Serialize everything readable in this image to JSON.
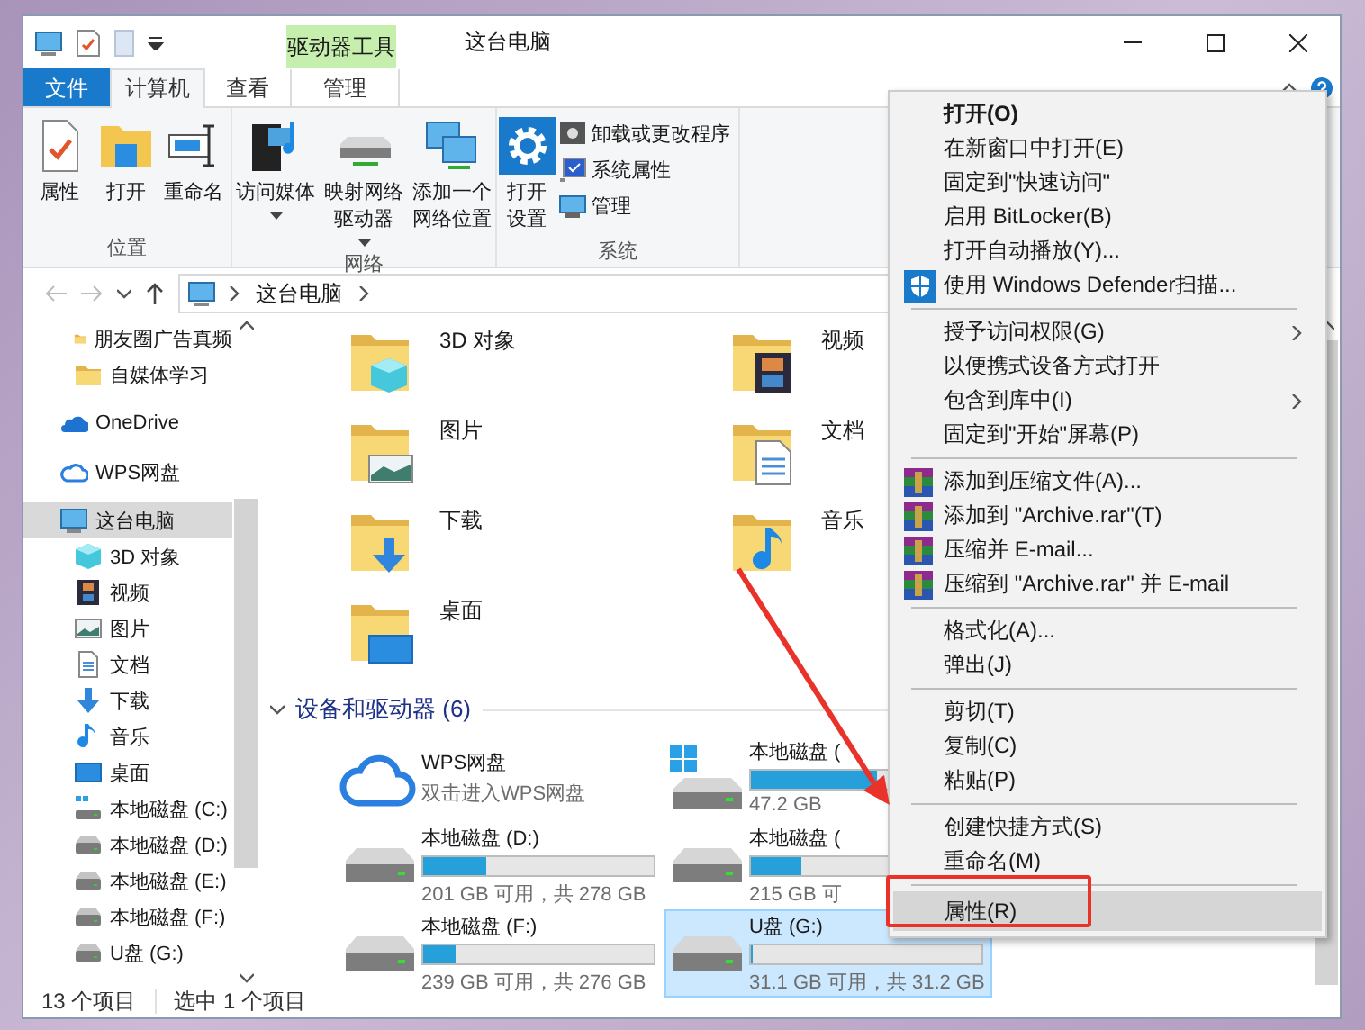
{
  "window": {
    "title": "这台电脑",
    "context_tab_group": "驱动器工具"
  },
  "tabs": [
    {
      "label": "文件",
      "kind": "file",
      "selected": false
    },
    {
      "label": "计算机",
      "kind": "normal",
      "selected": true
    },
    {
      "label": "查看",
      "kind": "normal",
      "selected": false
    },
    {
      "label": "管理",
      "kind": "context",
      "selected": false
    }
  ],
  "ribbon": {
    "groups": [
      {
        "label": "位置",
        "large_buttons": [
          {
            "label": "属性",
            "kind": "properties",
            "dropdown": false
          },
          {
            "label": "打开",
            "kind": "open",
            "dropdown": false
          },
          {
            "label": "重命名",
            "kind": "rename",
            "dropdown": false
          }
        ]
      },
      {
        "label": "网络",
        "large_buttons": [
          {
            "label": "访问媒体",
            "kind": "media",
            "dropdown": true
          },
          {
            "label": "映射网络驱动器",
            "kind": "map-drive",
            "dropdown": true
          },
          {
            "label": "添加一个网络位置",
            "kind": "network-location",
            "dropdown": false
          }
        ]
      },
      {
        "label": "系统",
        "large_buttons": [
          {
            "label": "打开设置",
            "kind": "settings",
            "dropdown": false
          }
        ],
        "small_buttons": [
          {
            "label": "卸载或更改程序",
            "kind": "programs"
          },
          {
            "label": "系统属性",
            "kind": "system-properties"
          },
          {
            "label": "管理",
            "kind": "manage"
          }
        ]
      }
    ]
  },
  "address": {
    "path": [
      "这台电脑"
    ]
  },
  "sidebar": {
    "items": [
      {
        "label": "朋友圈广告真频",
        "kind": "folder",
        "selected": false
      },
      {
        "label": "自媒体学习",
        "kind": "folder",
        "selected": false
      },
      {
        "label": "OneDrive",
        "kind": "onedrive",
        "selected": false
      },
      {
        "label": "WPS网盘",
        "kind": "cloud",
        "selected": false
      },
      {
        "label": "这台电脑",
        "kind": "computer",
        "selected": true,
        "children": [
          {
            "label": "3D 对象",
            "kind": "cube",
            "selected": false
          },
          {
            "label": "视频",
            "kind": "video",
            "selected": false
          },
          {
            "label": "图片",
            "kind": "picture",
            "selected": false
          },
          {
            "label": "文档",
            "kind": "document",
            "selected": false
          },
          {
            "label": "下载",
            "kind": "download",
            "selected": false
          },
          {
            "label": "音乐",
            "kind": "music",
            "selected": false
          },
          {
            "label": "桌面",
            "kind": "desktop",
            "selected": false
          },
          {
            "label": "本地磁盘 (C:)",
            "kind": "system-drive",
            "selected": false
          },
          {
            "label": "本地磁盘 (D:)",
            "kind": "drive",
            "selected": false
          },
          {
            "label": "本地磁盘 (E:)",
            "kind": "drive",
            "selected": false
          },
          {
            "label": "本地磁盘 (F:)",
            "kind": "drive",
            "selected": false
          },
          {
            "label": "U盘 (G:)",
            "kind": "drive",
            "selected": false
          }
        ]
      }
    ]
  },
  "folders": [
    {
      "label": "3D 对象",
      "kind": "cube"
    },
    {
      "label": "视频",
      "kind": "video"
    },
    {
      "label": "图片",
      "kind": "picture"
    },
    {
      "label": "文档",
      "kind": "document"
    },
    {
      "label": "下载",
      "kind": "download"
    },
    {
      "label": "音乐",
      "kind": "music"
    },
    {
      "label": "桌面",
      "kind": "desktop"
    }
  ],
  "devices": {
    "title": "设备和驱动器 (6)",
    "expanded": true,
    "drives": [
      {
        "name": "WPS网盘",
        "kind": "cloud",
        "subtitle": "双击进入WPS网盘",
        "selected": false
      },
      {
        "name": "本地磁盘 (",
        "kind": "system-drive",
        "level": 0.55,
        "free": "47.2 GB",
        "selected": false
      },
      {
        "name": "本地磁盘 (D:)",
        "kind": "drive",
        "level": 0.27,
        "free": "201 GB 可用，共 278 GB",
        "selected": false
      },
      {
        "name": "本地磁盘 (",
        "kind": "drive",
        "level": 0.22,
        "free": "215 GB 可",
        "selected": false
      },
      {
        "name": "本地磁盘 (F:)",
        "kind": "drive",
        "level": 0.14,
        "free": "239 GB 可用，共 276 GB",
        "selected": false
      },
      {
        "name": "U盘 (G:)",
        "kind": "drive",
        "level": 0.01,
        "free": "31.1 GB 可用，共 31.2 GB",
        "selected": true
      }
    ]
  },
  "status_bar": {
    "count": "13 个项目",
    "selection": "选中 1 个项目"
  },
  "context_menu": {
    "items": [
      {
        "kind": "command",
        "label": "打开(O)",
        "default": true,
        "submenu": false,
        "selected": false
      },
      {
        "kind": "command",
        "label": "在新窗口中打开(E)",
        "default": false,
        "submenu": false,
        "selected": false
      },
      {
        "kind": "command",
        "label": "固定到\"快速访问\"",
        "default": false,
        "submenu": false,
        "selected": false
      },
      {
        "kind": "command",
        "label": "启用 BitLocker(B)",
        "default": false,
        "submenu": false,
        "selected": false
      },
      {
        "kind": "command",
        "label": "打开自动播放(Y)...",
        "default": false,
        "submenu": false,
        "selected": false
      },
      {
        "kind": "shield",
        "label": "使用 Windows Defender扫描...",
        "default": false,
        "submenu": false,
        "selected": false
      },
      {
        "kind": "separator"
      },
      {
        "kind": "command",
        "label": "授予访问权限(G)",
        "default": false,
        "submenu": true,
        "selected": false
      },
      {
        "kind": "command",
        "label": "以便携式设备方式打开",
        "default": false,
        "submenu": false,
        "selected": false
      },
      {
        "kind": "command",
        "label": "包含到库中(I)",
        "default": false,
        "submenu": true,
        "selected": false
      },
      {
        "kind": "command",
        "label": "固定到\"开始\"屏幕(P)",
        "default": false,
        "submenu": false,
        "selected": false
      },
      {
        "kind": "separator"
      },
      {
        "kind": "archive",
        "label": "添加到压缩文件(A)...",
        "default": false,
        "submenu": false,
        "selected": false
      },
      {
        "kind": "archive",
        "label": "添加到 \"Archive.rar\"(T)",
        "default": false,
        "submenu": false,
        "selected": false
      },
      {
        "kind": "archive",
        "label": "压缩并 E-mail...",
        "default": false,
        "submenu": false,
        "selected": false
      },
      {
        "kind": "archive",
        "label": "压缩到 \"Archive.rar\" 并 E-mail",
        "default": false,
        "submenu": false,
        "selected": false
      },
      {
        "kind": "separator"
      },
      {
        "kind": "command",
        "label": "格式化(A)...",
        "default": false,
        "submenu": false,
        "selected": false
      },
      {
        "kind": "command",
        "label": "弹出(J)",
        "default": false,
        "submenu": false,
        "selected": false
      },
      {
        "kind": "separator"
      },
      {
        "kind": "command",
        "label": "剪切(T)",
        "default": false,
        "submenu": false,
        "selected": false
      },
      {
        "kind": "command",
        "label": "复制(C)",
        "default": false,
        "submenu": false,
        "selected": false
      },
      {
        "kind": "command",
        "label": "粘贴(P)",
        "default": false,
        "submenu": false,
        "selected": false
      },
      {
        "kind": "separator"
      },
      {
        "kind": "command",
        "label": "创建快捷方式(S)",
        "default": false,
        "submenu": false,
        "selected": false
      },
      {
        "kind": "command",
        "label": "重命名(M)",
        "default": false,
        "submenu": false,
        "selected": false
      },
      {
        "kind": "separator"
      },
      {
        "kind": "command",
        "label": "属性(R)",
        "default": false,
        "submenu": false,
        "selected": true
      }
    ]
  }
}
